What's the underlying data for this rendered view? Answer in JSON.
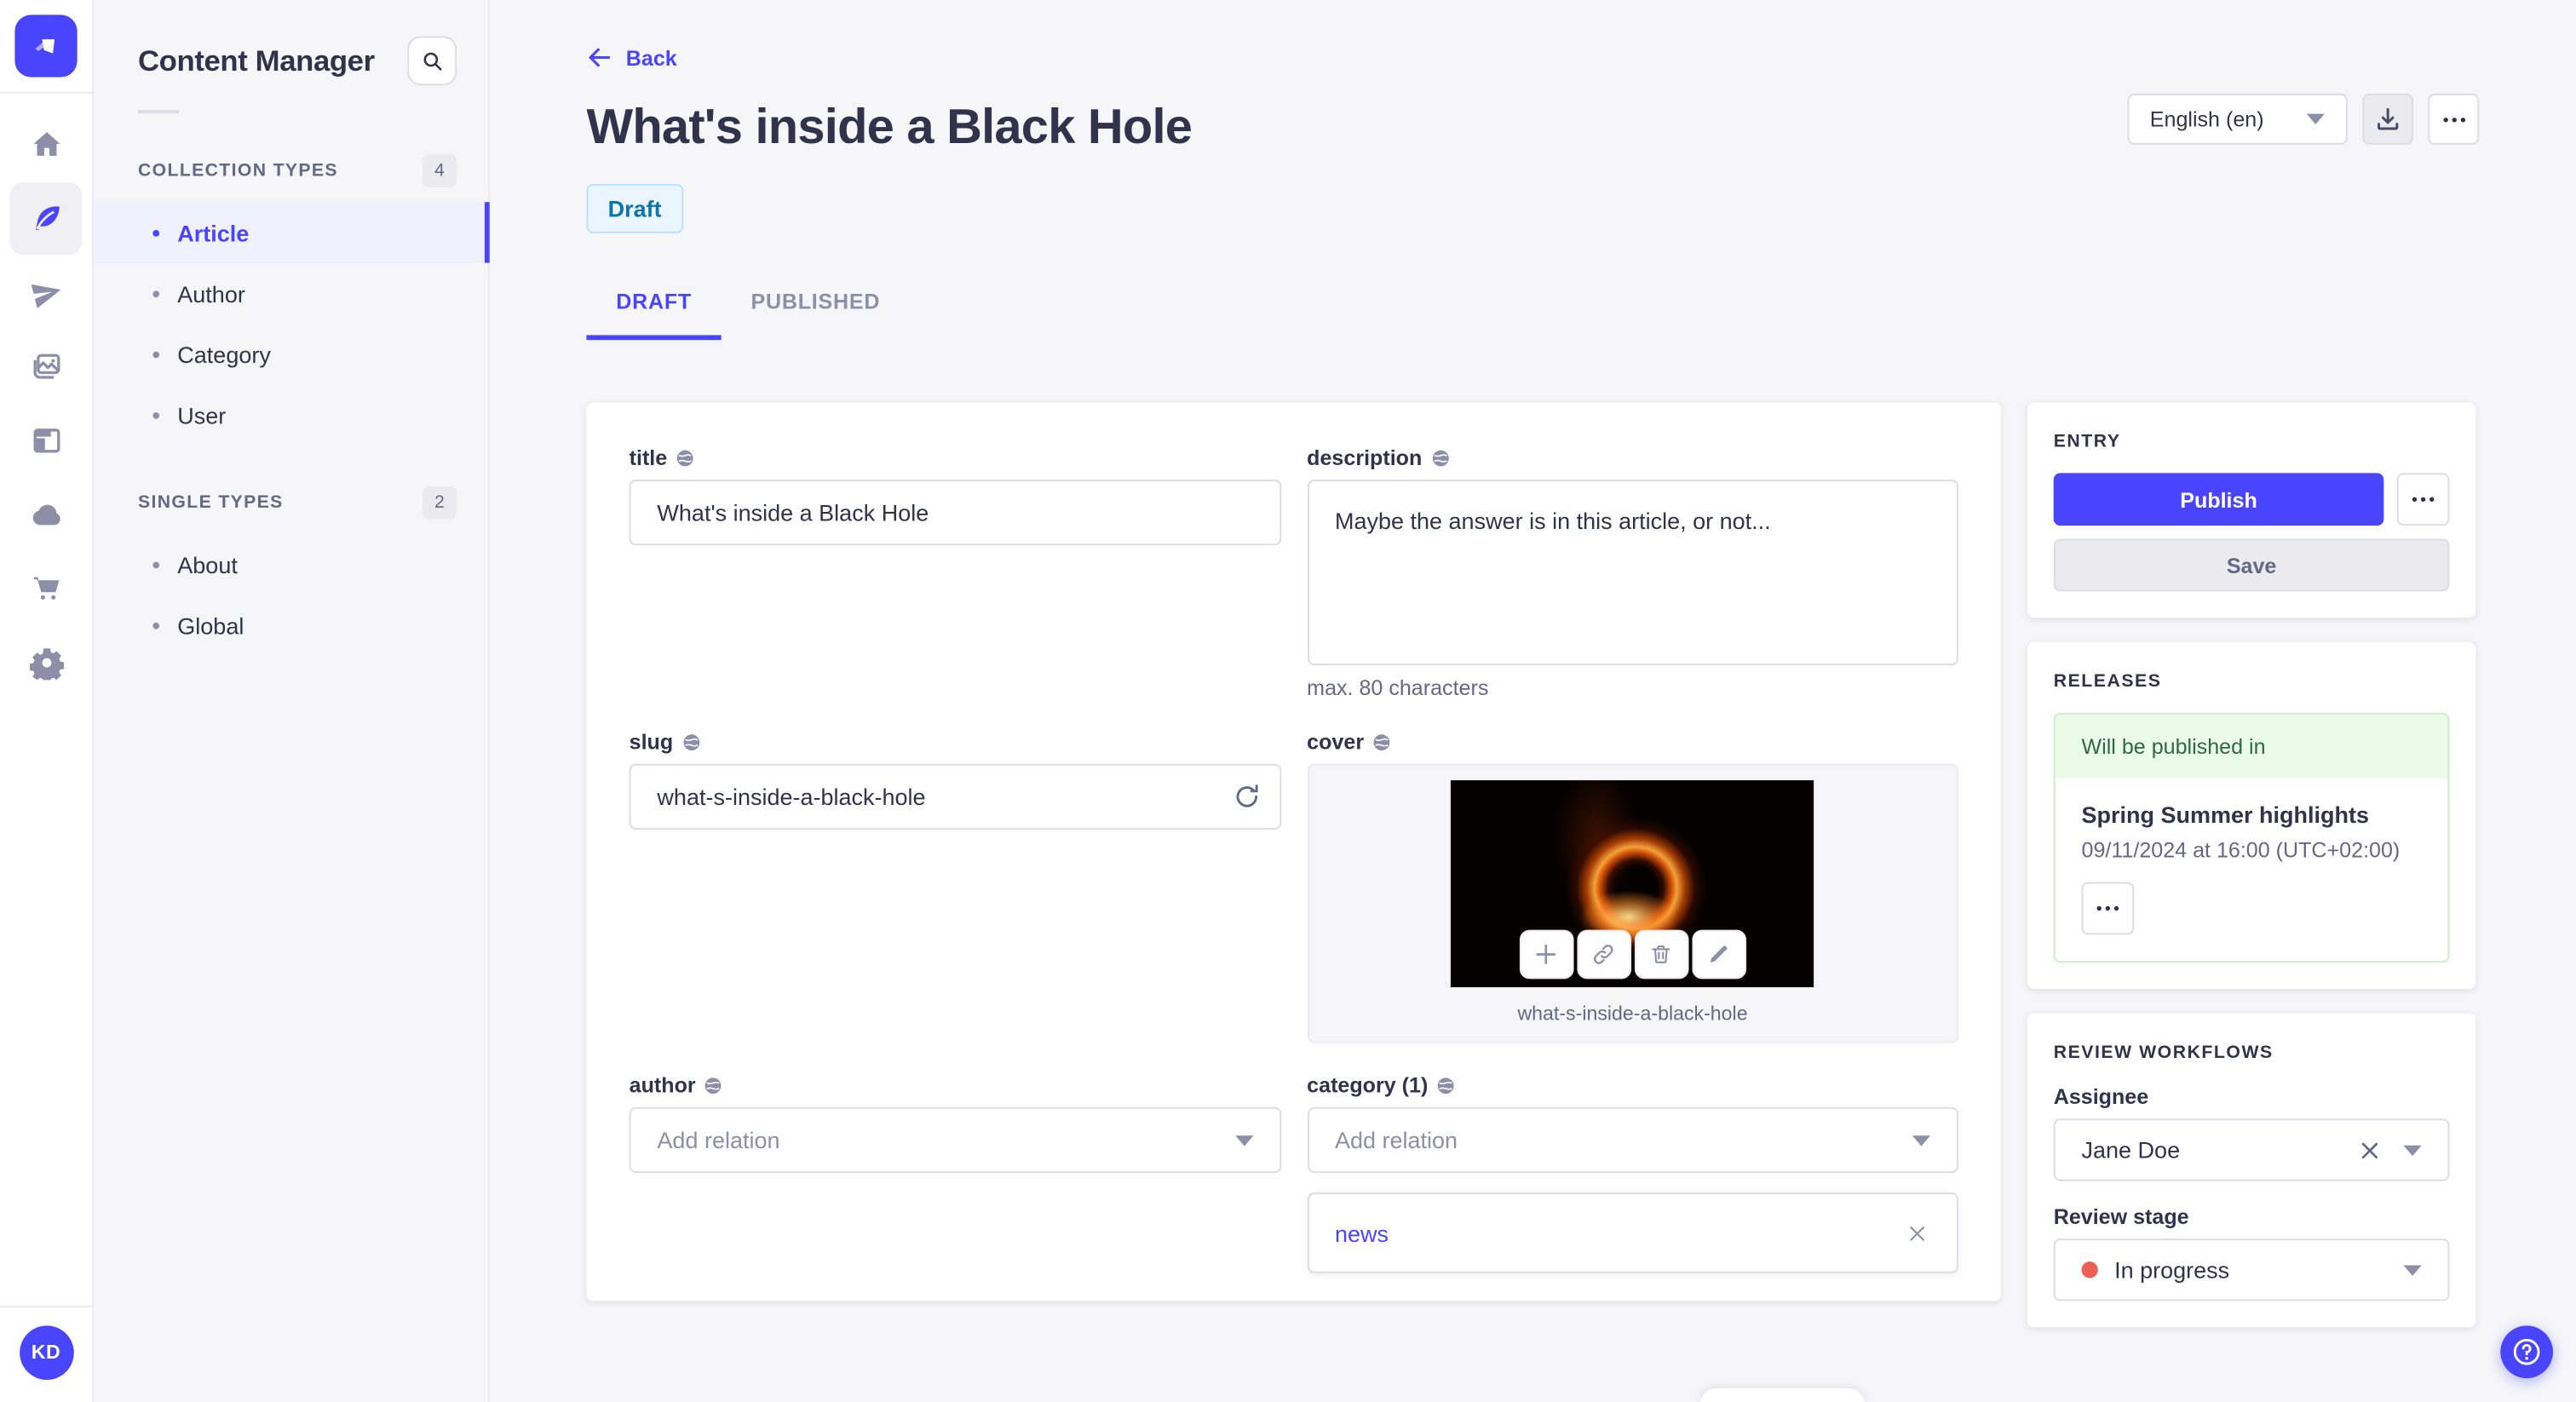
{
  "colors": {
    "accent": "#4945ff",
    "accent_light": "#f0f0ff",
    "draft_bg": "#eaf5ff",
    "draft_border": "#b8e1ff",
    "draft_text": "#0c75af",
    "success_bg": "#eafbe7",
    "success_border": "#c6f0c2",
    "success_text": "#2f6846",
    "danger": "#ee5e52",
    "text": "#32324d",
    "text_muted": "#666687",
    "placeholder": "#8e8ea9",
    "border": "#dcdce4",
    "background": "#f6f6f9"
  },
  "rail": {
    "logo_icon": "strapi-logo",
    "items": [
      {
        "icon": "home-icon"
      },
      {
        "icon": "feather-icon",
        "active": true
      },
      {
        "icon": "paper-plane-icon"
      },
      {
        "icon": "media-library-icon"
      },
      {
        "icon": "layout-icon"
      },
      {
        "icon": "cloud-icon"
      },
      {
        "icon": "cart-icon"
      },
      {
        "icon": "gear-icon"
      }
    ],
    "avatar_initials": "KD"
  },
  "sidebar": {
    "title": "Content Manager",
    "search_icon": "search-icon",
    "sections": [
      {
        "label": "COLLECTION TYPES",
        "count": "4",
        "items": [
          {
            "label": "Article",
            "active": true
          },
          {
            "label": "Author"
          },
          {
            "label": "Category"
          },
          {
            "label": "User"
          }
        ]
      },
      {
        "label": "SINGLE TYPES",
        "count": "2",
        "items": [
          {
            "label": "About"
          },
          {
            "label": "Global"
          }
        ]
      }
    ]
  },
  "header": {
    "back_label": "Back",
    "title": "What's inside a Black Hole",
    "status_badge": "Draft",
    "locale_value": "English (en)"
  },
  "tabs": {
    "draft": "DRAFT",
    "published": "PUBLISHED"
  },
  "form": {
    "title": {
      "label": "title",
      "value": "What's inside a Black Hole"
    },
    "description": {
      "label": "description",
      "value": "Maybe the answer is in this article, or not...",
      "hint": "max. 80 characters"
    },
    "slug": {
      "label": "slug",
      "value": "what-s-inside-a-black-hole"
    },
    "cover": {
      "label": "cover",
      "caption": "what-s-inside-a-black-hole"
    },
    "author": {
      "label": "author",
      "placeholder": "Add relation"
    },
    "category": {
      "label": "category (1)",
      "placeholder": "Add relation",
      "relations": [
        {
          "label": "news"
        }
      ]
    }
  },
  "entry_panel": {
    "header": "ENTRY",
    "publish_label": "Publish",
    "save_label": "Save"
  },
  "releases_panel": {
    "header": "RELEASES",
    "status": "Will be published in",
    "release_title": "Spring Summer highlights",
    "release_date": "09/11/2024 at 16:00 (UTC+02:00)"
  },
  "review_panel": {
    "header": "REVIEW WORKFLOWS",
    "assignee_label": "Assignee",
    "assignee_value": "Jane Doe",
    "stage_label": "Review stage",
    "stage_value": "In progress"
  }
}
